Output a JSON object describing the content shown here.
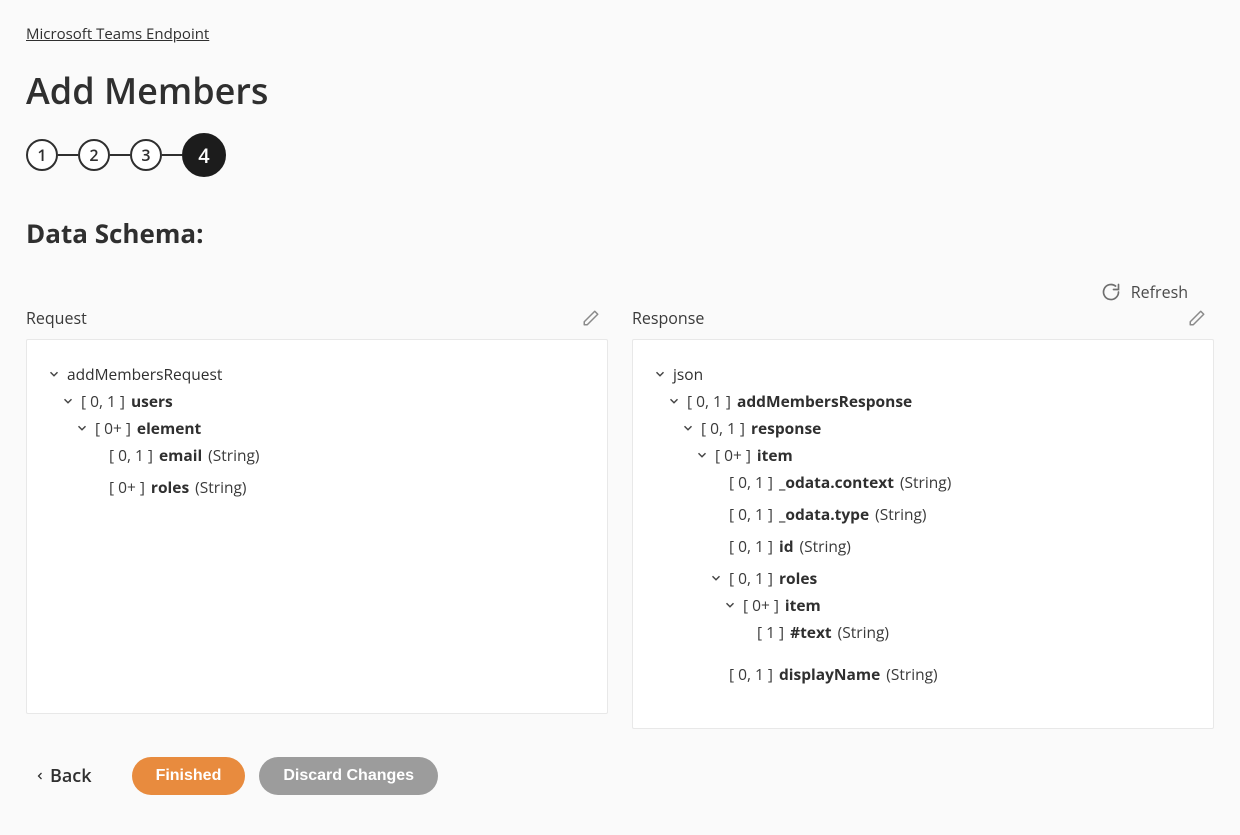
{
  "breadcrumb": "Microsoft Teams Endpoint",
  "page_title": "Add Members",
  "stepper": {
    "steps": [
      "1",
      "2",
      "3",
      "4"
    ],
    "active_index": 3
  },
  "section_heading": "Data Schema:",
  "refresh_label": "Refresh",
  "request": {
    "label": "Request",
    "root": {
      "name": "addMembersRequest"
    },
    "users": {
      "card": "[ 0, 1 ]",
      "name": "users"
    },
    "element": {
      "card": "[ 0+ ]",
      "name": "element"
    },
    "email": {
      "card": "[ 0, 1 ]",
      "name": "email",
      "type": "(String)"
    },
    "roles": {
      "card": "[ 0+ ]",
      "name": "roles",
      "type": "(String)"
    }
  },
  "response": {
    "label": "Response",
    "root": {
      "name": "json"
    },
    "addMembersResponse": {
      "card": "[ 0, 1 ]",
      "name": "addMembersResponse"
    },
    "responseNode": {
      "card": "[ 0, 1 ]",
      "name": "response"
    },
    "item1": {
      "card": "[ 0+ ]",
      "name": "item"
    },
    "odata_context": {
      "card": "[ 0, 1 ]",
      "name": "_odata.context",
      "type": "(String)"
    },
    "odata_type": {
      "card": "[ 0, 1 ]",
      "name": "_odata.type",
      "type": "(String)"
    },
    "id": {
      "card": "[ 0, 1 ]",
      "name": "id",
      "type": "(String)"
    },
    "roles": {
      "card": "[ 0, 1 ]",
      "name": "roles"
    },
    "item2": {
      "card": "[ 0+ ]",
      "name": "item"
    },
    "text": {
      "card": "[ 1 ]",
      "name": "#text",
      "type": "(String)"
    },
    "displayName": {
      "card": "[ 0, 1 ]",
      "name": "displayName",
      "type": "(String)"
    }
  },
  "footer": {
    "back": "Back",
    "finished": "Finished",
    "discard": "Discard Changes"
  }
}
